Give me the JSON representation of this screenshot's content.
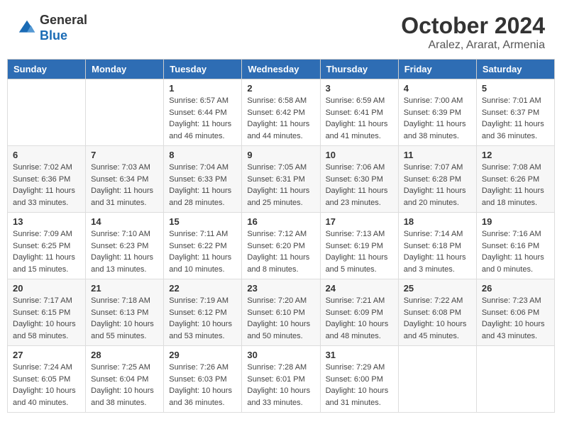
{
  "header": {
    "logo_line1": "General",
    "logo_line2": "Blue",
    "title": "October 2024",
    "subtitle": "Aralez, Ararat, Armenia"
  },
  "calendar": {
    "days_of_week": [
      "Sunday",
      "Monday",
      "Tuesday",
      "Wednesday",
      "Thursday",
      "Friday",
      "Saturday"
    ],
    "weeks": [
      [
        {
          "day": "",
          "info": ""
        },
        {
          "day": "",
          "info": ""
        },
        {
          "day": "1",
          "info": "Sunrise: 6:57 AM\nSunset: 6:44 PM\nDaylight: 11 hours and 46 minutes."
        },
        {
          "day": "2",
          "info": "Sunrise: 6:58 AM\nSunset: 6:42 PM\nDaylight: 11 hours and 44 minutes."
        },
        {
          "day": "3",
          "info": "Sunrise: 6:59 AM\nSunset: 6:41 PM\nDaylight: 11 hours and 41 minutes."
        },
        {
          "day": "4",
          "info": "Sunrise: 7:00 AM\nSunset: 6:39 PM\nDaylight: 11 hours and 38 minutes."
        },
        {
          "day": "5",
          "info": "Sunrise: 7:01 AM\nSunset: 6:37 PM\nDaylight: 11 hours and 36 minutes."
        }
      ],
      [
        {
          "day": "6",
          "info": "Sunrise: 7:02 AM\nSunset: 6:36 PM\nDaylight: 11 hours and 33 minutes."
        },
        {
          "day": "7",
          "info": "Sunrise: 7:03 AM\nSunset: 6:34 PM\nDaylight: 11 hours and 31 minutes."
        },
        {
          "day": "8",
          "info": "Sunrise: 7:04 AM\nSunset: 6:33 PM\nDaylight: 11 hours and 28 minutes."
        },
        {
          "day": "9",
          "info": "Sunrise: 7:05 AM\nSunset: 6:31 PM\nDaylight: 11 hours and 25 minutes."
        },
        {
          "day": "10",
          "info": "Sunrise: 7:06 AM\nSunset: 6:30 PM\nDaylight: 11 hours and 23 minutes."
        },
        {
          "day": "11",
          "info": "Sunrise: 7:07 AM\nSunset: 6:28 PM\nDaylight: 11 hours and 20 minutes."
        },
        {
          "day": "12",
          "info": "Sunrise: 7:08 AM\nSunset: 6:26 PM\nDaylight: 11 hours and 18 minutes."
        }
      ],
      [
        {
          "day": "13",
          "info": "Sunrise: 7:09 AM\nSunset: 6:25 PM\nDaylight: 11 hours and 15 minutes."
        },
        {
          "day": "14",
          "info": "Sunrise: 7:10 AM\nSunset: 6:23 PM\nDaylight: 11 hours and 13 minutes."
        },
        {
          "day": "15",
          "info": "Sunrise: 7:11 AM\nSunset: 6:22 PM\nDaylight: 11 hours and 10 minutes."
        },
        {
          "day": "16",
          "info": "Sunrise: 7:12 AM\nSunset: 6:20 PM\nDaylight: 11 hours and 8 minutes."
        },
        {
          "day": "17",
          "info": "Sunrise: 7:13 AM\nSunset: 6:19 PM\nDaylight: 11 hours and 5 minutes."
        },
        {
          "day": "18",
          "info": "Sunrise: 7:14 AM\nSunset: 6:18 PM\nDaylight: 11 hours and 3 minutes."
        },
        {
          "day": "19",
          "info": "Sunrise: 7:16 AM\nSunset: 6:16 PM\nDaylight: 11 hours and 0 minutes."
        }
      ],
      [
        {
          "day": "20",
          "info": "Sunrise: 7:17 AM\nSunset: 6:15 PM\nDaylight: 10 hours and 58 minutes."
        },
        {
          "day": "21",
          "info": "Sunrise: 7:18 AM\nSunset: 6:13 PM\nDaylight: 10 hours and 55 minutes."
        },
        {
          "day": "22",
          "info": "Sunrise: 7:19 AM\nSunset: 6:12 PM\nDaylight: 10 hours and 53 minutes."
        },
        {
          "day": "23",
          "info": "Sunrise: 7:20 AM\nSunset: 6:10 PM\nDaylight: 10 hours and 50 minutes."
        },
        {
          "day": "24",
          "info": "Sunrise: 7:21 AM\nSunset: 6:09 PM\nDaylight: 10 hours and 48 minutes."
        },
        {
          "day": "25",
          "info": "Sunrise: 7:22 AM\nSunset: 6:08 PM\nDaylight: 10 hours and 45 minutes."
        },
        {
          "day": "26",
          "info": "Sunrise: 7:23 AM\nSunset: 6:06 PM\nDaylight: 10 hours and 43 minutes."
        }
      ],
      [
        {
          "day": "27",
          "info": "Sunrise: 7:24 AM\nSunset: 6:05 PM\nDaylight: 10 hours and 40 minutes."
        },
        {
          "day": "28",
          "info": "Sunrise: 7:25 AM\nSunset: 6:04 PM\nDaylight: 10 hours and 38 minutes."
        },
        {
          "day": "29",
          "info": "Sunrise: 7:26 AM\nSunset: 6:03 PM\nDaylight: 10 hours and 36 minutes."
        },
        {
          "day": "30",
          "info": "Sunrise: 7:28 AM\nSunset: 6:01 PM\nDaylight: 10 hours and 33 minutes."
        },
        {
          "day": "31",
          "info": "Sunrise: 7:29 AM\nSunset: 6:00 PM\nDaylight: 10 hours and 31 minutes."
        },
        {
          "day": "",
          "info": ""
        },
        {
          "day": "",
          "info": ""
        }
      ]
    ]
  }
}
